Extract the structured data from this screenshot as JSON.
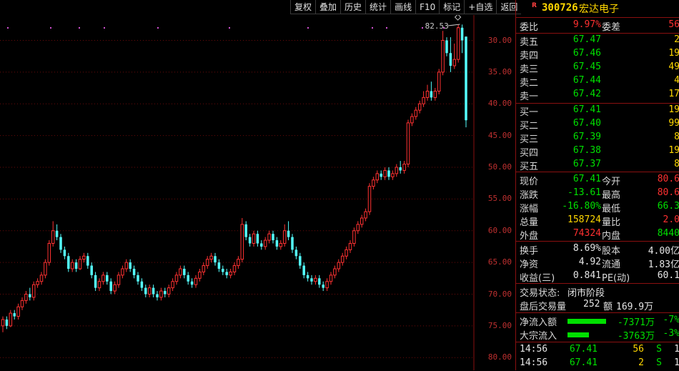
{
  "toolbar": [
    "复权",
    "叠加",
    "历史",
    "统计",
    "画线",
    "F10",
    "标记",
    "+自选",
    "返回"
  ],
  "chart": {
    "max_label": "82.53",
    "y_ticks": [
      "80.00",
      "75.00",
      "70.00",
      "65.00",
      "60.00",
      "55.00",
      "50.00",
      "45.00",
      "40.00",
      "35.00",
      "30.00"
    ]
  },
  "chart_data": {
    "type": "candlestick",
    "ylim": [
      28,
      84
    ],
    "y_ticks": [
      30,
      35,
      40,
      45,
      50,
      55,
      60,
      65,
      70,
      75,
      80
    ],
    "max_annotation": 82.53,
    "candles": [
      [
        35,
        36,
        34,
        36.5
      ],
      [
        36,
        35,
        34.5,
        36.5
      ],
      [
        35,
        37,
        34.8,
        37.5
      ],
      [
        37,
        36.5,
        36,
        37.5
      ],
      [
        36.5,
        38,
        36,
        38.5
      ],
      [
        38,
        39,
        37.5,
        39.5
      ],
      [
        39,
        40,
        38.5,
        40.5
      ],
      [
        40,
        39.5,
        39,
        41
      ],
      [
        39.5,
        41.5,
        39,
        42
      ],
      [
        41.5,
        42,
        41,
        42.5
      ],
      [
        42,
        43,
        41.5,
        43.5
      ],
      [
        43,
        45,
        42.5,
        45.5
      ],
      [
        45,
        48,
        44.5,
        48.5
      ],
      [
        48,
        50,
        47.5,
        51.5
      ],
      [
        50,
        49,
        48.5,
        51
      ],
      [
        49,
        47,
        46.5,
        49.5
      ],
      [
        47,
        46,
        45.5,
        47.5
      ],
      [
        46,
        44,
        43.5,
        46.5
      ],
      [
        44,
        45,
        43.5,
        45.5
      ],
      [
        45,
        44,
        43.5,
        45.5
      ],
      [
        44,
        45.5,
        43.8,
        46
      ],
      [
        45.5,
        46,
        45,
        46.5
      ],
      [
        46,
        44.5,
        44,
        46.5
      ],
      [
        44.5,
        43,
        42.5,
        45
      ],
      [
        43,
        41,
        40.5,
        43.5
      ],
      [
        41,
        42,
        40.5,
        42.5
      ],
      [
        42,
        43,
        41.5,
        43.5
      ],
      [
        43,
        42,
        41.5,
        43.5
      ],
      [
        42,
        40.5,
        40,
        42.5
      ],
      [
        40.5,
        41.5,
        40,
        42
      ],
      [
        41.5,
        43,
        41,
        43.5
      ],
      [
        43,
        44,
        42.5,
        44.5
      ],
      [
        44,
        45,
        43.5,
        45.5
      ],
      [
        45,
        44,
        43.5,
        45.5
      ],
      [
        44,
        43,
        42.5,
        44.5
      ],
      [
        43,
        42,
        41.5,
        43.5
      ],
      [
        42,
        41,
        40.5,
        42.5
      ],
      [
        41,
        40,
        39.5,
        41.5
      ],
      [
        40,
        41,
        39.5,
        41.5
      ],
      [
        41,
        40,
        39.5,
        41.5
      ],
      [
        40,
        39.5,
        39,
        40.5
      ],
      [
        39.5,
        40.5,
        39,
        41
      ],
      [
        40.5,
        40,
        39.5,
        41
      ],
      [
        40,
        41,
        39.5,
        41.5
      ],
      [
        41,
        42,
        40.5,
        42.5
      ],
      [
        42,
        43,
        41.5,
        43.5
      ],
      [
        43,
        44,
        42.5,
        44.5
      ],
      [
        44,
        43,
        42.5,
        44.5
      ],
      [
        43,
        42,
        41.5,
        43.5
      ],
      [
        42,
        41.5,
        41,
        42.5
      ],
      [
        41.5,
        42.5,
        41,
        43
      ],
      [
        42.5,
        43.5,
        42,
        44
      ],
      [
        43.5,
        44.5,
        43,
        45
      ],
      [
        44.5,
        45.5,
        44,
        46
      ],
      [
        45.5,
        46,
        45,
        46.5
      ],
      [
        46,
        45,
        44.5,
        46.5
      ],
      [
        45,
        44,
        43.5,
        45.5
      ],
      [
        44,
        43.5,
        43,
        44.5
      ],
      [
        43.5,
        43,
        42.5,
        44
      ],
      [
        43,
        43.5,
        42.5,
        44
      ],
      [
        43.5,
        44.5,
        43,
        45
      ],
      [
        44.5,
        45.5,
        44,
        46
      ],
      [
        45.5,
        51,
        45,
        52
      ],
      [
        51,
        49,
        48.5,
        51.5
      ],
      [
        49,
        48,
        47.5,
        49.5
      ],
      [
        48,
        49.5,
        47.5,
        50
      ],
      [
        49.5,
        48,
        47.5,
        50
      ],
      [
        48,
        47.5,
        47,
        48.5
      ],
      [
        47.5,
        48.5,
        47,
        49
      ],
      [
        48.5,
        49.5,
        48,
        50
      ],
      [
        49.5,
        48.5,
        48,
        50
      ],
      [
        48.5,
        47.5,
        47,
        49
      ],
      [
        47.5,
        48,
        47,
        48.5
      ],
      [
        48,
        50,
        47.5,
        51
      ],
      [
        50,
        49,
        48.5,
        51.5
      ],
      [
        49,
        47,
        46.5,
        49.5
      ],
      [
        47,
        46,
        45.5,
        47.5
      ],
      [
        46,
        44.5,
        44,
        46.5
      ],
      [
        44.5,
        43,
        42.5,
        45
      ],
      [
        43,
        42.5,
        42,
        43.5
      ],
      [
        42.5,
        42,
        41.5,
        43
      ],
      [
        42,
        42.5,
        41.5,
        43
      ],
      [
        42.5,
        41.5,
        41,
        43
      ],
      [
        41.5,
        41,
        40.5,
        42
      ],
      [
        41,
        42,
        40.5,
        42.5
      ],
      [
        42,
        43,
        41.5,
        43.5
      ],
      [
        43,
        44,
        42.5,
        44.5
      ],
      [
        44,
        45,
        43.5,
        45.5
      ],
      [
        45,
        46,
        44.5,
        46.5
      ],
      [
        46,
        47,
        45.5,
        47.5
      ],
      [
        47,
        48,
        46.5,
        48.5
      ],
      [
        48,
        50,
        47.5,
        50.5
      ],
      [
        50,
        51,
        49.5,
        51.5
      ],
      [
        51,
        52,
        50.5,
        52.5
      ],
      [
        52,
        53,
        51.5,
        53.5
      ],
      [
        53,
        57,
        52.5,
        57.5
      ],
      [
        57,
        58,
        56.5,
        58.5
      ],
      [
        58,
        59,
        57.5,
        59.5
      ],
      [
        59,
        58.5,
        58,
        59.5
      ],
      [
        58.5,
        59.5,
        58,
        60
      ],
      [
        59.5,
        58.5,
        58,
        60
      ],
      [
        58.5,
        59,
        58,
        59.5
      ],
      [
        59,
        60,
        58.5,
        60.5
      ],
      [
        60,
        59.5,
        59,
        61
      ],
      [
        59.5,
        60.5,
        59,
        61
      ],
      [
        60.5,
        67,
        60,
        67.5
      ],
      [
        67,
        68,
        66.5,
        68.5
      ],
      [
        68,
        69,
        67.5,
        69.5
      ],
      [
        69,
        70,
        68.5,
        70.5
      ],
      [
        70,
        71,
        69.5,
        72
      ],
      [
        71,
        72,
        70.5,
        73
      ],
      [
        72,
        71,
        70.5,
        73.5
      ],
      [
        71,
        72,
        70.5,
        72.5
      ],
      [
        72,
        75,
        71.5,
        75.5
      ],
      [
        75,
        80,
        74.5,
        81.5
      ],
      [
        80,
        78,
        77.5,
        80.5
      ],
      [
        78,
        76,
        75,
        80.5
      ],
      [
        76,
        77,
        75.5,
        79.5
      ],
      [
        77,
        82,
        76.5,
        82.53
      ],
      [
        82,
        80,
        78,
        82.5
      ],
      [
        80.6,
        67.41,
        66.3,
        80.6
      ]
    ]
  },
  "panel": {
    "r_mark": "R",
    "code": "300726",
    "name": "宏达电子",
    "weibi": {
      "label1": "委比",
      "value": "9.97%",
      "label2": "委差",
      "value2": "56"
    },
    "sell": [
      {
        "label": "卖五",
        "price": "67.47",
        "vol": "2"
      },
      {
        "label": "卖四",
        "price": "67.46",
        "vol": "19"
      },
      {
        "label": "卖三",
        "price": "67.45",
        "vol": "49"
      },
      {
        "label": "卖二",
        "price": "67.44",
        "vol": "4"
      },
      {
        "label": "卖一",
        "price": "67.42",
        "vol": "17"
      }
    ],
    "buy": [
      {
        "label": "买一",
        "price": "67.41",
        "vol": "19"
      },
      {
        "label": "买二",
        "price": "67.40",
        "vol": "99"
      },
      {
        "label": "买三",
        "price": "67.39",
        "vol": "8"
      },
      {
        "label": "买四",
        "price": "67.38",
        "vol": "19"
      },
      {
        "label": "买五",
        "price": "67.37",
        "vol": "8"
      }
    ],
    "quote": [
      {
        "l1": "现价",
        "v1": "67.41",
        "c1": "green",
        "l2": "今开",
        "v2": "80.6",
        "c2": "red"
      },
      {
        "l1": "涨跌",
        "v1": "-13.61",
        "c1": "green",
        "l2": "最高",
        "v2": "80.6",
        "c2": "red"
      },
      {
        "l1": "涨幅",
        "v1": "-16.80%",
        "c1": "green",
        "l2": "最低",
        "v2": "66.3",
        "c2": "green"
      },
      {
        "l1": "总量",
        "v1": "158724",
        "c1": "yellow",
        "l2": "量比",
        "v2": "2.0",
        "c2": "red"
      },
      {
        "l1": "外盘",
        "v1": "74324",
        "c1": "red",
        "l2": "内盘",
        "v2": "8440",
        "c2": "green"
      }
    ],
    "fund": [
      {
        "l1": "换手",
        "v1": "8.69%",
        "l2": "股本",
        "v2": "4.00亿"
      },
      {
        "l1": "净资",
        "v1": "4.92",
        "l2": "流通",
        "v2": "1.83亿"
      },
      {
        "l1": "收益(三)",
        "v1": "0.841",
        "l2": "PE(动)",
        "v2": "60.1"
      }
    ],
    "status": {
      "label": "交易状态:",
      "value": "闭市阶段"
    },
    "after": {
      "label": "盘后交易量",
      "vol": "252",
      "amt_label": "额",
      "amt": "169.9万"
    },
    "flow": [
      {
        "label": "净流入额",
        "bar_fraction": 0.9,
        "value": "-7371万",
        "pct": "-7%"
      },
      {
        "label": "大宗流入",
        "bar_fraction": 0.5,
        "value": "-3763万",
        "pct": "-3%"
      }
    ],
    "ticks": [
      {
        "time": "14:56",
        "price": "67.41",
        "vol": "56",
        "side": "S",
        "n": "1"
      },
      {
        "time": "14:56",
        "price": "67.41",
        "vol": "2",
        "side": "S",
        "n": "1"
      }
    ]
  }
}
